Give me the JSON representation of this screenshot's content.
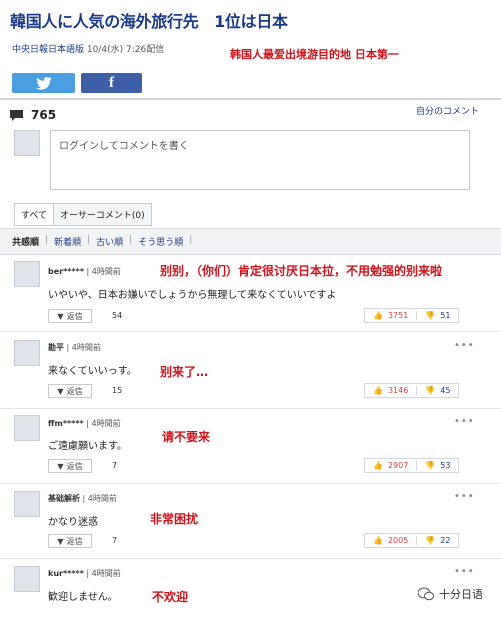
{
  "article": {
    "title": "韓国人に人気の海外旅行先　1位は日本",
    "source_name": "中央日報日本語版",
    "date": "10/4(水) 7:26配信",
    "title_translation": "韩国人最爱出境游目的地 日本第一"
  },
  "share": {
    "twitter_icon": "twitter-bird-icon",
    "facebook_icon": "facebook-f-icon"
  },
  "comments_header": {
    "count": "765",
    "my_comments_label": "自分のコメント"
  },
  "comment_input": {
    "placeholder": "ログインしてコメントを書く"
  },
  "tabs": [
    "すべて",
    "オーサーコメント(0)"
  ],
  "sort": {
    "items": [
      "共感順",
      "新着順",
      "古い順",
      "そう思う順"
    ],
    "separator": "|"
  },
  "comments": [
    {
      "user": "ber*****",
      "time": "4時間前",
      "text": "いやいや、日本お嫌いでしょうから無理して来なくていいですよ",
      "reply_label": "返信",
      "reply_count": "54",
      "likes": "3751",
      "dislikes": "51",
      "note": "别别，（你们）肯定很讨厌日本拉，不用勉强的别来啦"
    },
    {
      "user": "勘平",
      "time": "4時間前",
      "text": "来なくていいっす。",
      "reply_label": "返信",
      "reply_count": "15",
      "likes": "3146",
      "dislikes": "45",
      "note": "别来了…"
    },
    {
      "user": "ffm*****",
      "time": "4時間前",
      "text": "ご遠慮願います。",
      "reply_label": "返信",
      "reply_count": "7",
      "likes": "2907",
      "dislikes": "53",
      "note": "请不要来"
    },
    {
      "user": "基础解析",
      "time": "4時間前",
      "text": "かなり迷惑",
      "reply_label": "返信",
      "reply_count": "7",
      "likes": "2005",
      "dislikes": "22",
      "note": "非常困扰"
    },
    {
      "user": "kur*****",
      "time": "4時間前",
      "text": "歓迎しません。",
      "note": "不欢迎"
    }
  ],
  "watermark": {
    "text": "十分日语"
  },
  "colors": {
    "title_blue": "#1b3a86",
    "note_red": "#d0121b",
    "twitter": "#4a9fe2",
    "facebook": "#3c5fa8"
  }
}
